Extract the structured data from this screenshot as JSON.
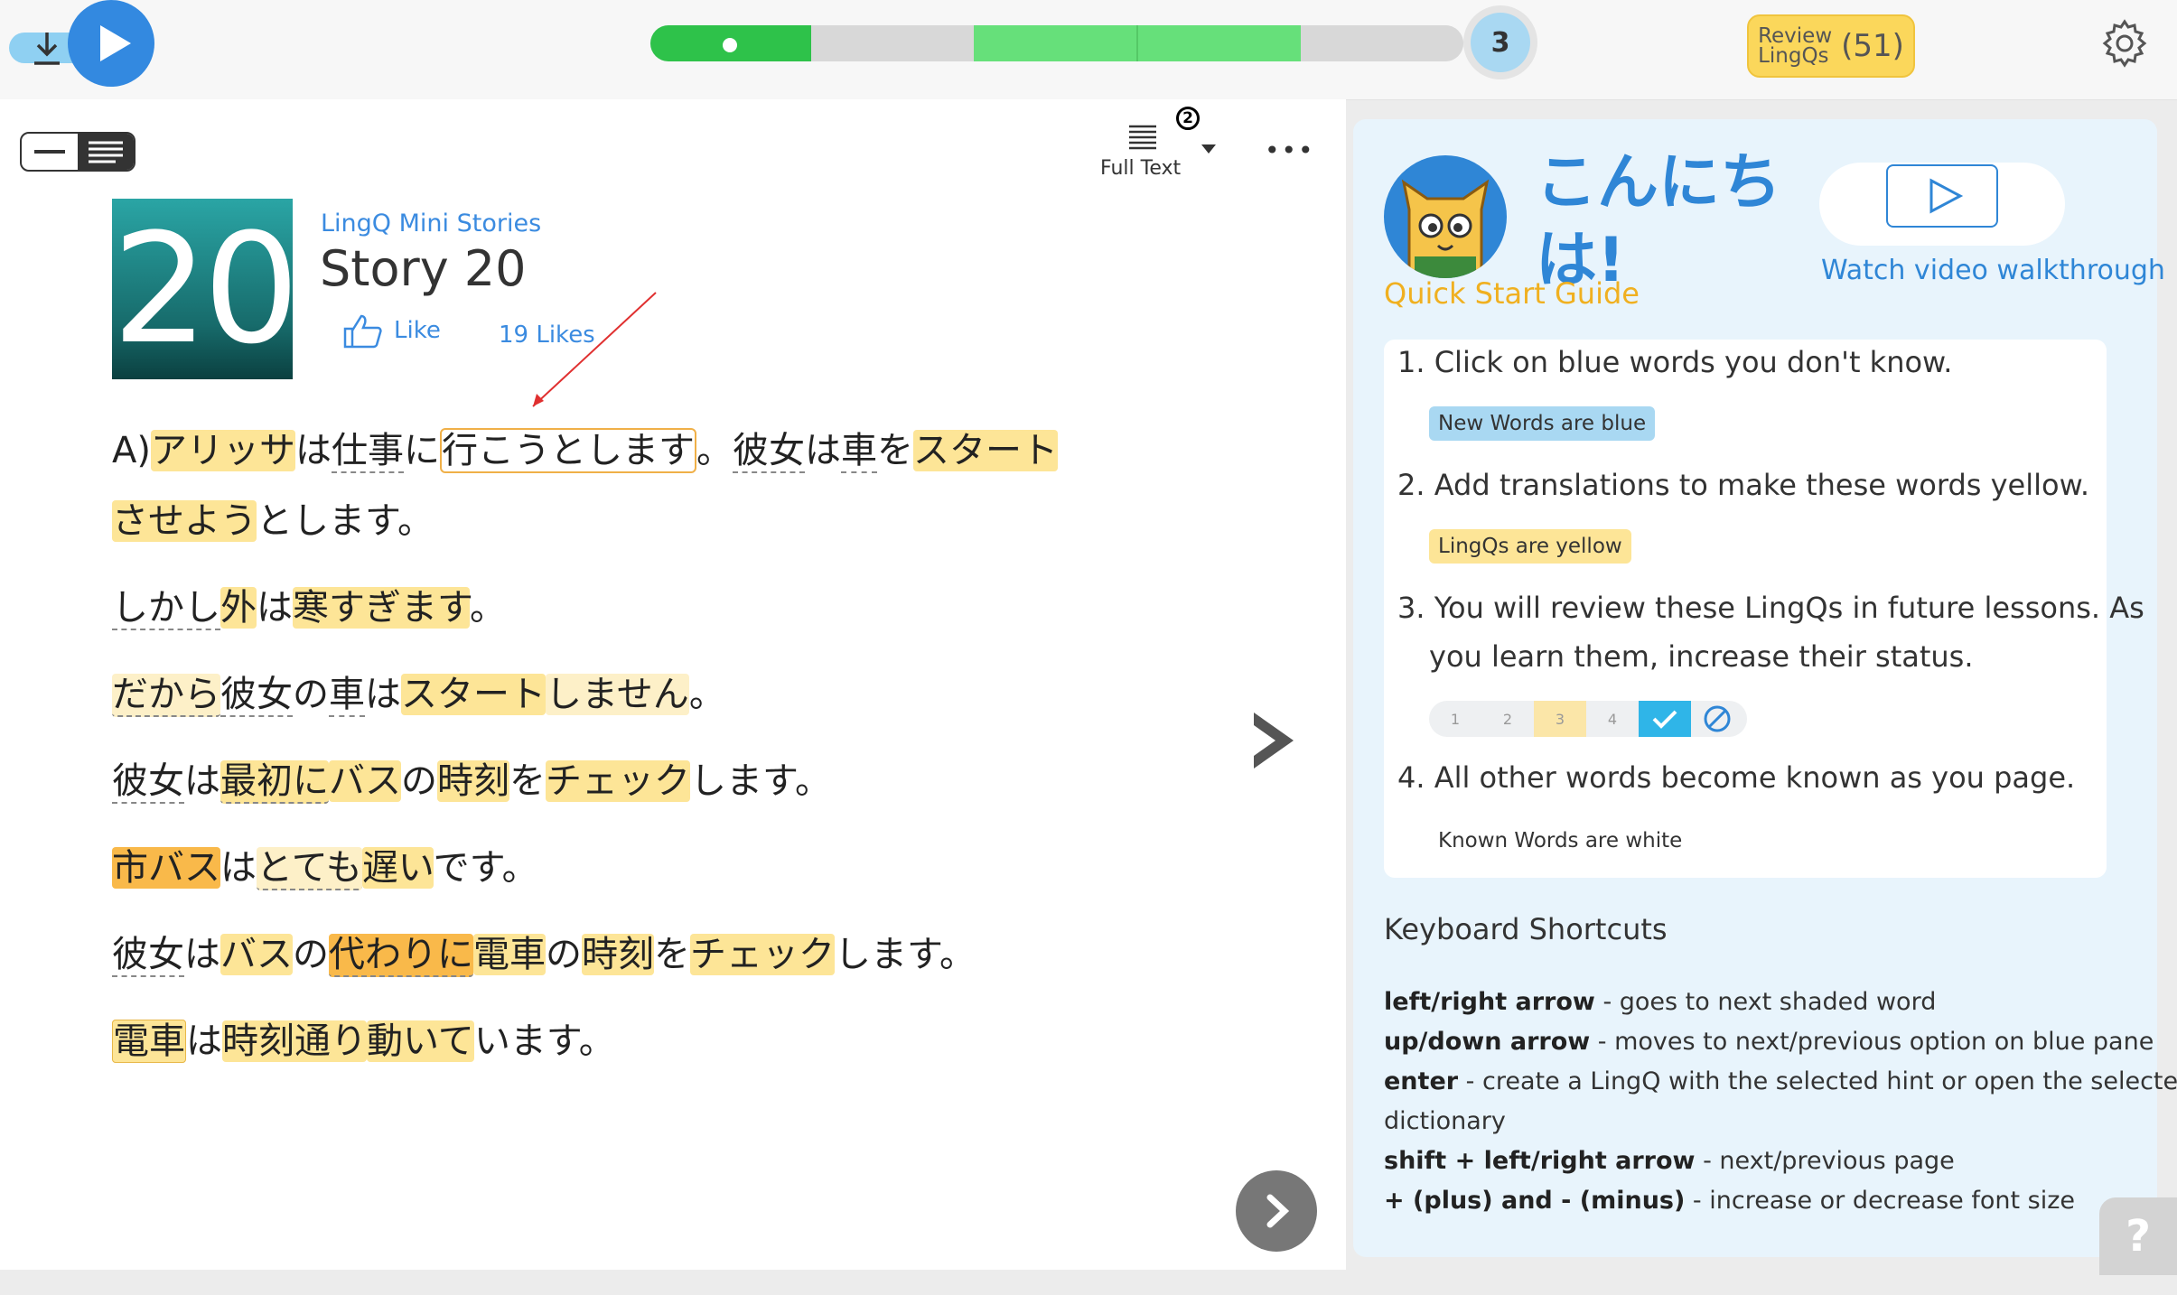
{
  "topbar": {
    "page_number": "3",
    "review_label_1": "Review",
    "review_label_2": "LingQs",
    "review_count": "(51)"
  },
  "toolbar": {
    "view_label": "Full Text",
    "notification_count": "2",
    "more_label": "•••"
  },
  "lesson": {
    "thumbnail_number": "20",
    "course": "LingQ Mini Stories",
    "title": "Story 20",
    "like_label": "Like",
    "likes_label": "19 Likes"
  },
  "text_lines": [
    "A)アリッサは仕事に行こうとします。彼女は車をスタート",
    "させようとします。",
    "しかし外は寒すぎます。",
    "だから彼女の車はスタートしません。",
    "彼女は最初にバスの時刻をチェックします。",
    "市バスはとても遅いです。",
    "彼女はバスの代わりに電車の時刻をチェックします。",
    "電車は時刻通り動いています。"
  ],
  "guide": {
    "greeting": "こんにちは!",
    "quick_start": "Quick Start Guide",
    "video_label": "Watch video walkthrough",
    "step1": "1. Click on blue words you don't know.",
    "new_words_pill": "New Words are blue",
    "step2": "2. Add translations to make these words yellow.",
    "lingqs_pill": "LingQs are yellow",
    "step3a": "3. You will review these LingQs in future lessons. As",
    "step3b": "you learn them, increase their status.",
    "status": [
      "1",
      "2",
      "3",
      "4"
    ],
    "step4": "4. All other words become known as you page.",
    "known_label": "Known Words are white"
  },
  "shortcuts": {
    "title": "Keyboard Shortcuts",
    "items": [
      {
        "key": "left/right arrow",
        "desc": " - goes to next shaded word"
      },
      {
        "key": "up/down arrow",
        "desc": " - moves to next/previous option on blue pane"
      },
      {
        "key": "enter",
        "desc": " - create a LingQ with the selected hint or open the selected"
      },
      {
        "key": "",
        "desc": "dictionary"
      },
      {
        "key": "shift + left/right arrow",
        "desc": " - next/previous page"
      },
      {
        "key": "+ (plus) and - (minus)",
        "desc": " - increase or decrease font size"
      }
    ]
  },
  "help_label": "?",
  "colors": {
    "accent_blue": "#3389e0",
    "lingq_yellow": "#fde597",
    "progress_green": "#2ec24a",
    "progress_light_green": "#66e07a"
  }
}
